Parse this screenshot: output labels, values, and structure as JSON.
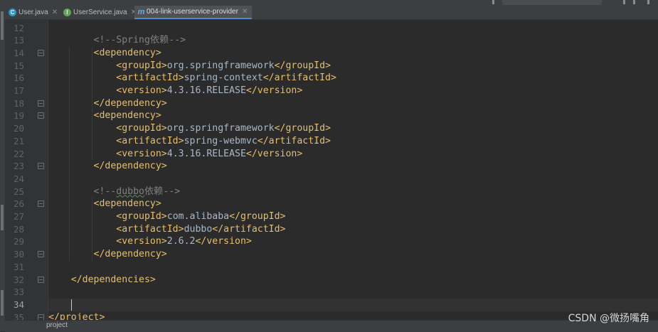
{
  "tabs": [
    {
      "label": "User.java",
      "icon": "class-icon",
      "active": false
    },
    {
      "label": "UserService.java",
      "icon": "interface-icon",
      "active": false
    },
    {
      "label": "004-link-userservice-provider",
      "icon": "maven-icon",
      "active": true
    }
  ],
  "editor": {
    "current_line": "34",
    "lines": [
      {
        "no": "12",
        "parts": []
      },
      {
        "no": "13",
        "parts": [
          {
            "t": "        "
          },
          {
            "c": "<!--Spring依赖-->"
          }
        ]
      },
      {
        "no": "14",
        "parts": [
          {
            "t": "        "
          },
          {
            "g": "<dependency>"
          }
        ]
      },
      {
        "no": "15",
        "parts": [
          {
            "t": "            "
          },
          {
            "g": "<groupId>"
          },
          {
            "t": "org.springframework"
          },
          {
            "g": "</groupId>"
          }
        ]
      },
      {
        "no": "16",
        "parts": [
          {
            "t": "            "
          },
          {
            "g": "<artifactId>"
          },
          {
            "t": "spring-context"
          },
          {
            "g": "</artifactId>"
          }
        ]
      },
      {
        "no": "17",
        "parts": [
          {
            "t": "            "
          },
          {
            "g": "<version>"
          },
          {
            "t": "4.3.16.RELEASE"
          },
          {
            "g": "</version>"
          }
        ]
      },
      {
        "no": "18",
        "parts": [
          {
            "t": "        "
          },
          {
            "g": "</dependency>"
          }
        ]
      },
      {
        "no": "19",
        "parts": [
          {
            "t": "        "
          },
          {
            "g": "<dependency>"
          }
        ]
      },
      {
        "no": "20",
        "parts": [
          {
            "t": "            "
          },
          {
            "g": "<groupId>"
          },
          {
            "t": "org.springframework"
          },
          {
            "g": "</groupId>"
          }
        ]
      },
      {
        "no": "21",
        "parts": [
          {
            "t": "            "
          },
          {
            "g": "<artifactId>"
          },
          {
            "t": "spring-webmvc"
          },
          {
            "g": "</artifactId>"
          }
        ]
      },
      {
        "no": "22",
        "parts": [
          {
            "t": "            "
          },
          {
            "g": "<version>"
          },
          {
            "t": "4.3.16.RELEASE"
          },
          {
            "g": "</version>"
          }
        ]
      },
      {
        "no": "23",
        "parts": [
          {
            "t": "        "
          },
          {
            "g": "</dependency>"
          }
        ]
      },
      {
        "no": "24",
        "parts": []
      },
      {
        "no": "25",
        "parts": [
          {
            "t": "        "
          },
          {
            "c": "<!--"
          },
          {
            "cs": "dubbo"
          },
          {
            "c": "依赖-->"
          }
        ]
      },
      {
        "no": "26",
        "parts": [
          {
            "t": "        "
          },
          {
            "g": "<dependency>"
          }
        ]
      },
      {
        "no": "27",
        "parts": [
          {
            "t": "            "
          },
          {
            "g": "<groupId>"
          },
          {
            "t": "com.alibaba"
          },
          {
            "g": "</groupId>"
          }
        ]
      },
      {
        "no": "28",
        "parts": [
          {
            "t": "            "
          },
          {
            "g": "<artifactId>"
          },
          {
            "t": "dubbo"
          },
          {
            "g": "</artifactId>"
          }
        ]
      },
      {
        "no": "29",
        "parts": [
          {
            "t": "            "
          },
          {
            "g": "<version>"
          },
          {
            "t": "2.6.2"
          },
          {
            "g": "</version>"
          }
        ]
      },
      {
        "no": "30",
        "parts": [
          {
            "t": "        "
          },
          {
            "g": "</dependency>"
          }
        ]
      },
      {
        "no": "31",
        "parts": []
      },
      {
        "no": "32",
        "parts": [
          {
            "t": "    "
          },
          {
            "g": "</dependencies>"
          }
        ]
      },
      {
        "no": "33",
        "parts": []
      },
      {
        "no": "34",
        "parts": []
      },
      {
        "no": "35",
        "parts": [
          {
            "g": "</project>"
          }
        ]
      }
    ],
    "folds": [
      "14",
      "18",
      "19",
      "23",
      "26",
      "30",
      "32",
      "35"
    ]
  },
  "breadcrumb": "project",
  "watermark": "CSDN @微扬嘴角",
  "colors": {
    "background": "#2b2b2b",
    "tag": "#e8bf6a",
    "text": "#a9b7c6",
    "comment": "#808080",
    "line_number": "#606366"
  }
}
